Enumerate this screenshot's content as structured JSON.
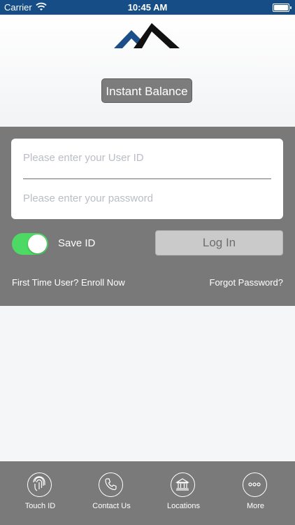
{
  "status_bar": {
    "carrier": "Carrier",
    "time": "10:45 AM"
  },
  "header": {
    "instant_balance_label": "Instant Balance"
  },
  "login": {
    "user_id_placeholder": "Please enter your User ID",
    "password_placeholder": "Please enter your password",
    "save_id_label": "Save ID",
    "save_id_on": true,
    "login_label": "Log In",
    "enroll_label": "First Time User? Enroll Now",
    "forgot_label": "Forgot Password?"
  },
  "tabbar": {
    "items": [
      {
        "label": "Touch ID",
        "icon": "fingerprint-icon"
      },
      {
        "label": "Contact Us",
        "icon": "phone-icon"
      },
      {
        "label": "Locations",
        "icon": "bank-icon"
      },
      {
        "label": "More",
        "icon": "more-dots-icon"
      }
    ]
  },
  "colors": {
    "status_bar": "#174d86",
    "panel": "#797979",
    "toggle_on": "#4cd964",
    "logo_blue": "#1c4f8a",
    "logo_black": "#111111"
  }
}
